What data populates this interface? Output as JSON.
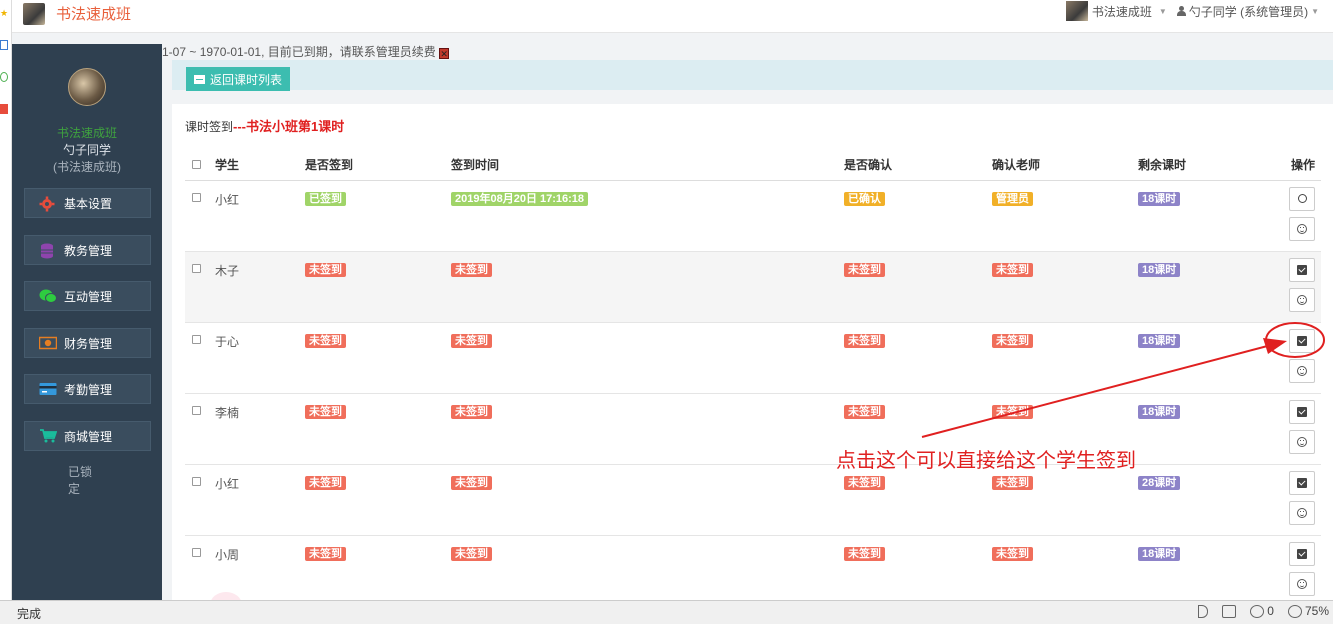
{
  "topbar": {
    "title": "书法速成班",
    "school_menu": "书法速成班",
    "user_menu": "勺子同学 (系统管理员)"
  },
  "notice": {
    "text": "1-07 ~ 1970-01-01, 目前已到期，请联系管理员续费"
  },
  "sidebar": {
    "school": "书法速成班",
    "user": "勺子同学",
    "user_school": "(书法速成班)",
    "items": [
      {
        "label": "基本设置",
        "icon": "gear-icon",
        "color": "#e74c3c"
      },
      {
        "label": "教务管理",
        "icon": "database-icon",
        "color": "#8e44ad"
      },
      {
        "label": "互动管理",
        "icon": "wechat-icon",
        "color": "#2ecc40"
      },
      {
        "label": "财务管理",
        "icon": "money-icon",
        "color": "#e67e22"
      },
      {
        "label": "考勤管理",
        "icon": "card-icon",
        "color": "#3498db"
      },
      {
        "label": "商城管理",
        "icon": "cart-icon",
        "color": "#1abc9c"
      }
    ],
    "locked": "已锁定"
  },
  "main": {
    "back_button": "返回课时列表",
    "heading_prefix": "课时签到",
    "heading_course": "---书法小班第1课时",
    "columns": [
      "学生",
      "是否签到",
      "签到时间",
      "是否确认",
      "确认老师",
      "剩余课时",
      "操作"
    ],
    "rows": [
      {
        "student": "小红",
        "signed": "已签到",
        "time": "2019年08月20日 17:16:18",
        "confirmed": "已确认",
        "teacher": "管理员",
        "remaining": "18课时"
      },
      {
        "student": "木子",
        "signed": "未签到",
        "time": "未签到",
        "confirmed": "未签到",
        "teacher": "未签到",
        "remaining": "18课时"
      },
      {
        "student": "于心",
        "signed": "未签到",
        "time": "未签到",
        "confirmed": "未签到",
        "teacher": "未签到",
        "remaining": "18课时"
      },
      {
        "student": "李楠",
        "signed": "未签到",
        "time": "未签到",
        "confirmed": "未签到",
        "teacher": "未签到",
        "remaining": "18课时"
      },
      {
        "student": "小红",
        "signed": "未签到",
        "time": "未签到",
        "confirmed": "未签到",
        "teacher": "未签到",
        "remaining": "28课时"
      },
      {
        "student": "小周",
        "signed": "未签到",
        "time": "未签到",
        "confirmed": "未签到",
        "teacher": "未签到",
        "remaining": "18课时"
      }
    ]
  },
  "annotation": {
    "text": "点击这个可以直接给这个学生签到",
    "color": "#e02020"
  },
  "statusbar": {
    "status": "完成",
    "ad_count": "0",
    "zoom": "75%"
  }
}
